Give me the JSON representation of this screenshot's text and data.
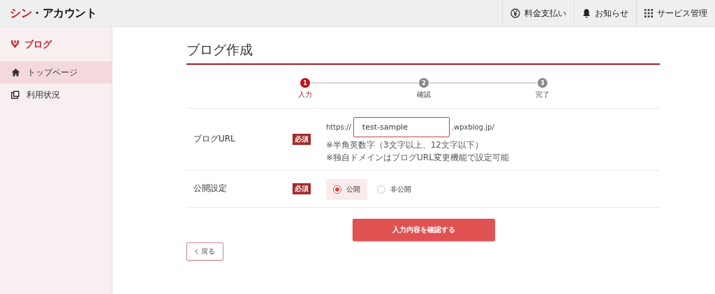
{
  "header": {
    "logo": {
      "accent": "シン",
      "rest": "・アカウント"
    },
    "nav": [
      {
        "label": "料金支払い"
      },
      {
        "label": "お知らせ"
      },
      {
        "label": "サービス管理"
      }
    ]
  },
  "sidebar": {
    "title": "ブログ",
    "items": [
      {
        "label": "トップページ",
        "selected": true
      },
      {
        "label": "利用状況",
        "selected": false
      }
    ]
  },
  "main": {
    "title": "ブログ作成",
    "steps": [
      {
        "number": "1",
        "label": "入力",
        "selected": true
      },
      {
        "number": "2",
        "label": "確認",
        "selected": false
      },
      {
        "number": "3",
        "label": "完了",
        "selected": false
      }
    ],
    "fields": [
      {
        "kind": "url",
        "label": "ブログURL",
        "badge": "必須",
        "prefix": "https://",
        "value": "test-sample",
        "suffix": ".wpxblog.jp/",
        "hints": [
          "※半角英数字（3文字以上、12文字以下）",
          "※独自ドメインはブログURL変更機能で設定可能"
        ]
      },
      {
        "kind": "radio",
        "label": "公開設定",
        "badge": "必須",
        "options": [
          {
            "label": "公開",
            "selected": true
          },
          {
            "label": "非公開",
            "selected": false
          }
        ]
      }
    ],
    "submit_button": "入力内容を確認する",
    "back_button": "戻る"
  }
}
